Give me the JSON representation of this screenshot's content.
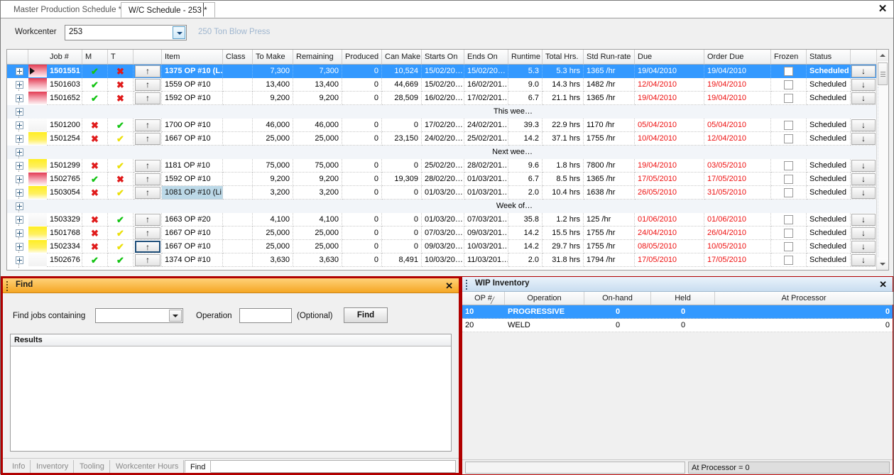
{
  "window": {
    "close_label": "✕"
  },
  "tabs": [
    {
      "label": "Master Production Schedule *",
      "active": false
    },
    {
      "label": "W/C Schedule - 253 *",
      "active": true
    }
  ],
  "workcenter": {
    "label": "Workcenter",
    "value": "253",
    "placeholder": "",
    "description": "250 Ton Blow Press",
    "dropdown_icon": "chevron-down-icon"
  },
  "grid": {
    "columns": [
      {
        "key": "expander",
        "label": "",
        "align": "c"
      },
      {
        "key": "job",
        "label": "Job #",
        "align": "l"
      },
      {
        "key": "m",
        "label": "M",
        "align": "c"
      },
      {
        "key": "t",
        "label": "T",
        "align": "c"
      },
      {
        "key": "up",
        "label": "",
        "align": "c"
      },
      {
        "key": "item",
        "label": "Item",
        "align": "l"
      },
      {
        "key": "class",
        "label": "Class",
        "align": "l"
      },
      {
        "key": "to_make",
        "label": "To Make",
        "align": "r"
      },
      {
        "key": "remaining",
        "label": "Remaining",
        "align": "r"
      },
      {
        "key": "produced",
        "label": "Produced",
        "align": "r"
      },
      {
        "key": "can_make",
        "label": "Can Make",
        "align": "r"
      },
      {
        "key": "starts_on",
        "label": "Starts On",
        "align": "l"
      },
      {
        "key": "ends_on",
        "label": "Ends On",
        "align": "l"
      },
      {
        "key": "runtime",
        "label": "Runtime",
        "align": "r"
      },
      {
        "key": "total_hrs",
        "label": "Total Hrs.",
        "align": "r"
      },
      {
        "key": "std_run_rate",
        "label": "Std Run-rate",
        "align": "l"
      },
      {
        "key": "due",
        "label": "Due",
        "align": "l"
      },
      {
        "key": "order_due",
        "label": "Order Due",
        "align": "l"
      },
      {
        "key": "frozen",
        "label": "Frozen",
        "align": "c"
      },
      {
        "key": "status",
        "label": "Status",
        "align": "l"
      },
      {
        "key": "down",
        "label": "",
        "align": "c"
      }
    ],
    "rows": [
      {
        "type": "data",
        "selected": true,
        "pointer": true,
        "swatch": "red",
        "job": "1501551",
        "m": "check",
        "t": "cross",
        "item": "1375 OP #10 (L…",
        "item_highlight": false,
        "class": "",
        "to_make": "7,300",
        "remaining": "7,300",
        "produced": "0",
        "can_make": "10,524",
        "starts_on": "15/02/20…",
        "ends_on": "15/02/20…",
        "runtime": "5.3",
        "total_hrs": "5.3 hrs",
        "std_run_rate": "1365 /hr",
        "due": "19/04/2010",
        "due_late": false,
        "order_due": "19/04/2010",
        "order_due_late": false,
        "frozen": false,
        "status": "Scheduled"
      },
      {
        "type": "data",
        "selected": false,
        "pointer": false,
        "swatch": "red",
        "job": "1501603",
        "m": "check",
        "t": "cross",
        "item": "1559 OP #10",
        "item_highlight": false,
        "class": "",
        "to_make": "13,400",
        "remaining": "13,400",
        "produced": "0",
        "can_make": "44,669",
        "starts_on": "15/02/20…",
        "ends_on": "16/02/201…",
        "runtime": "9.0",
        "total_hrs": "14.3 hrs",
        "std_run_rate": "1482 /hr",
        "due": "12/04/2010",
        "due_late": true,
        "order_due": "19/04/2010",
        "order_due_late": true,
        "frozen": false,
        "status": "Scheduled"
      },
      {
        "type": "data",
        "selected": false,
        "pointer": false,
        "swatch": "red",
        "job": "1501652",
        "m": "check",
        "t": "cross",
        "item": "1592 OP #10",
        "item_highlight": false,
        "class": "",
        "to_make": "9,200",
        "remaining": "9,200",
        "produced": "0",
        "can_make": "28,509",
        "starts_on": "16/02/20…",
        "ends_on": "17/02/201…",
        "runtime": "6.7",
        "total_hrs": "21.1 hrs",
        "std_run_rate": "1365 /hr",
        "due": "19/04/2010",
        "due_late": true,
        "order_due": "19/04/2010",
        "order_due_late": true,
        "frozen": false,
        "status": "Scheduled"
      },
      {
        "type": "separator",
        "label": "This wee…"
      },
      {
        "type": "data",
        "selected": false,
        "pointer": false,
        "swatch": "none",
        "job": "1501200",
        "m": "cross",
        "t": "check",
        "item": "1700 OP #10",
        "item_highlight": false,
        "class": "",
        "to_make": "46,000",
        "remaining": "46,000",
        "produced": "0",
        "can_make": "0",
        "starts_on": "17/02/20…",
        "ends_on": "24/02/201…",
        "runtime": "39.3",
        "total_hrs": "22.9 hrs",
        "std_run_rate": "1170 /hr",
        "due": "05/04/2010",
        "due_late": true,
        "order_due": "05/04/2010",
        "order_due_late": true,
        "frozen": false,
        "status": "Scheduled"
      },
      {
        "type": "data",
        "selected": false,
        "pointer": false,
        "swatch": "yellow",
        "job": "1501254",
        "m": "cross",
        "t": "ycheck",
        "item": "1667 OP #10",
        "item_highlight": false,
        "class": "",
        "to_make": "25,000",
        "remaining": "25,000",
        "produced": "0",
        "can_make": "23,150",
        "starts_on": "24/02/20…",
        "ends_on": "25/02/201…",
        "runtime": "14.2",
        "total_hrs": "37.1 hrs",
        "std_run_rate": "1755 /hr",
        "due": "10/04/2010",
        "due_late": true,
        "order_due": "12/04/2010",
        "order_due_late": true,
        "frozen": false,
        "status": "Scheduled"
      },
      {
        "type": "separator",
        "label": "Next wee…"
      },
      {
        "type": "data",
        "selected": false,
        "pointer": false,
        "swatch": "yellow",
        "job": "1501299",
        "m": "cross",
        "t": "ycheck",
        "item": "1181 OP #10",
        "item_highlight": false,
        "class": "",
        "to_make": "75,000",
        "remaining": "75,000",
        "produced": "0",
        "can_make": "0",
        "starts_on": "25/02/20…",
        "ends_on": "28/02/201…",
        "runtime": "9.6",
        "total_hrs": "1.8 hrs",
        "std_run_rate": "7800 /hr",
        "due": "19/04/2010",
        "due_late": true,
        "order_due": "03/05/2010",
        "order_due_late": true,
        "frozen": false,
        "status": "Scheduled"
      },
      {
        "type": "data",
        "selected": false,
        "pointer": false,
        "swatch": "red",
        "job": "1502765",
        "m": "check",
        "t": "cross",
        "item": "1592 OP #10",
        "item_highlight": false,
        "class": "",
        "to_make": "9,200",
        "remaining": "9,200",
        "produced": "0",
        "can_make": "19,309",
        "starts_on": "28/02/20…",
        "ends_on": "01/03/201…",
        "runtime": "6.7",
        "total_hrs": "8.5 hrs",
        "std_run_rate": "1365 /hr",
        "due": "17/05/2010",
        "due_late": true,
        "order_due": "17/05/2010",
        "order_due_late": true,
        "frozen": false,
        "status": "Scheduled"
      },
      {
        "type": "data",
        "selected": false,
        "pointer": false,
        "swatch": "yellow",
        "job": "1503054",
        "m": "cross",
        "t": "ycheck",
        "item": "1081 OP #10 (Li…",
        "item_highlight": true,
        "class": "",
        "to_make": "3,200",
        "remaining": "3,200",
        "produced": "0",
        "can_make": "0",
        "starts_on": "01/03/20…",
        "ends_on": "01/03/201…",
        "runtime": "2.0",
        "total_hrs": "10.4 hrs",
        "std_run_rate": "1638 /hr",
        "due": "26/05/2010",
        "due_late": true,
        "order_due": "31/05/2010",
        "order_due_late": true,
        "frozen": false,
        "status": "Scheduled"
      },
      {
        "type": "separator",
        "label": "Week of…"
      },
      {
        "type": "data",
        "selected": false,
        "pointer": false,
        "swatch": "none",
        "job": "1503329",
        "m": "cross",
        "t": "check",
        "item": "1663 OP #20",
        "item_highlight": false,
        "class": "",
        "to_make": "4,100",
        "remaining": "4,100",
        "produced": "0",
        "can_make": "0",
        "starts_on": "01/03/20…",
        "ends_on": "07/03/201…",
        "runtime": "35.8",
        "total_hrs": "1.2 hrs",
        "std_run_rate": "125 /hr",
        "due": "01/06/2010",
        "due_late": true,
        "order_due": "01/06/2010",
        "order_due_late": true,
        "frozen": false,
        "status": "Scheduled"
      },
      {
        "type": "data",
        "selected": false,
        "pointer": false,
        "swatch": "yellow",
        "job": "1501768",
        "m": "cross",
        "t": "ycheck",
        "item": "1667 OP #10",
        "item_highlight": false,
        "class": "",
        "to_make": "25,000",
        "remaining": "25,000",
        "produced": "0",
        "can_make": "0",
        "starts_on": "07/03/20…",
        "ends_on": "09/03/201…",
        "runtime": "14.2",
        "total_hrs": "15.5 hrs",
        "std_run_rate": "1755 /hr",
        "due": "24/04/2010",
        "due_late": true,
        "order_due": "26/04/2010",
        "order_due_late": true,
        "frozen": false,
        "status": "Scheduled"
      },
      {
        "type": "data",
        "selected": false,
        "pointer": false,
        "swatch": "yellow",
        "up_focused": true,
        "job": "1502334",
        "m": "cross",
        "t": "ycheck",
        "item": "1667 OP #10",
        "item_highlight": false,
        "class": "",
        "to_make": "25,000",
        "remaining": "25,000",
        "produced": "0",
        "can_make": "0",
        "starts_on": "09/03/20…",
        "ends_on": "10/03/201…",
        "runtime": "14.2",
        "total_hrs": "29.7 hrs",
        "std_run_rate": "1755 /hr",
        "due": "08/05/2010",
        "due_late": true,
        "order_due": "10/05/2010",
        "order_due_late": true,
        "frozen": false,
        "status": "Scheduled"
      },
      {
        "type": "data",
        "selected": false,
        "pointer": false,
        "swatch": "none",
        "job": "1502676",
        "m": "check",
        "t": "check",
        "item": "1374 OP #10",
        "item_highlight": false,
        "class": "",
        "to_make": "3,630",
        "remaining": "3,630",
        "produced": "0",
        "can_make": "8,491",
        "starts_on": "10/03/20…",
        "ends_on": "11/03/201…",
        "runtime": "2.0",
        "total_hrs": "31.8 hrs",
        "std_run_rate": "1794 /hr",
        "due": "17/05/2010",
        "due_late": true,
        "order_due": "17/05/2010",
        "order_due_late": true,
        "frozen": false,
        "status": "Scheduled"
      }
    ]
  },
  "find_panel": {
    "title": "Find",
    "close_label": "✕",
    "label_find_jobs": "Find jobs containing",
    "combo_value": "",
    "label_operation": "Operation",
    "operation_value": "",
    "optional_label": "(Optional)",
    "find_button": "Find",
    "results_header": "Results",
    "tabs": [
      {
        "label": "Info",
        "active": false
      },
      {
        "label": "Inventory",
        "active": false
      },
      {
        "label": "Tooling",
        "active": false
      },
      {
        "label": "Workcenter Hours",
        "active": false
      },
      {
        "label": "Find",
        "active": true
      }
    ]
  },
  "wip_panel": {
    "title": "WIP Inventory",
    "close_label": "✕",
    "columns": [
      {
        "label": "OP #",
        "sorted": true,
        "sort_icon": "sort-ascending-icon"
      },
      {
        "label": "Operation",
        "sorted": false
      },
      {
        "label": "On-hand",
        "sorted": false
      },
      {
        "label": "Held",
        "sorted": false
      },
      {
        "label": "At Processor",
        "sorted": false
      }
    ],
    "rows": [
      {
        "op": "10",
        "operation": "PROGRESSIVE",
        "on_hand": "0",
        "held": "0",
        "at_processor": "0",
        "selected": true
      },
      {
        "op": "20",
        "operation": "WELD",
        "on_hand": "0",
        "held": "0",
        "at_processor": "0",
        "selected": false
      }
    ],
    "status_left": "",
    "status_right": "At Processor = 0"
  },
  "colors": {
    "selection": "#3399ff",
    "find_title": "#f5a623",
    "panel_border": "#b00000",
    "late_date": "#ee1111",
    "ok_mark": "#14c414",
    "bad_mark": "#e01b1b",
    "warn_mark": "#ebe00c"
  }
}
